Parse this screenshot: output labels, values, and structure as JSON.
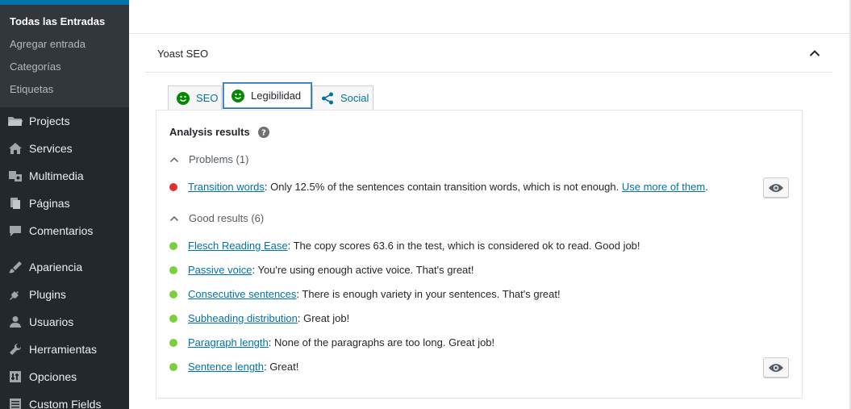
{
  "colors": {
    "sidebar_bg": "#23282d",
    "submenu_bg": "#32373c",
    "accent": "#0073aa",
    "bad": "#dc3232",
    "good": "#7ad03a",
    "yoast_green": "#008a00"
  },
  "sidebar": {
    "submenu": [
      {
        "label": "Todas las Entradas",
        "current": true
      },
      {
        "label": "Agregar entrada"
      },
      {
        "label": "Categorías"
      },
      {
        "label": "Etiquetas"
      }
    ],
    "items": [
      {
        "label": "Projects",
        "icon": "folder-icon"
      },
      {
        "label": "Services",
        "icon": "home-icon"
      },
      {
        "label": "Multimedia",
        "icon": "media-icon"
      },
      {
        "label": "Páginas",
        "icon": "pages-icon"
      },
      {
        "label": "Comentarios",
        "icon": "comments-icon"
      },
      {
        "label": "Apariencia",
        "icon": "appearance-icon"
      },
      {
        "label": "Plugins",
        "icon": "plugins-icon"
      },
      {
        "label": "Usuarios",
        "icon": "users-icon"
      },
      {
        "label": "Herramientas",
        "icon": "tools-icon"
      },
      {
        "label": "Opciones",
        "icon": "settings-icon"
      },
      {
        "label": "Custom Fields",
        "icon": "custom-fields-icon"
      }
    ]
  },
  "metabox": {
    "title": "Yoast SEO",
    "tabs": [
      {
        "label": "SEO",
        "icon": "smiley-icon"
      },
      {
        "label": "Legibilidad",
        "icon": "smiley-icon",
        "active": true
      },
      {
        "label": "Social",
        "icon": "share-icon"
      }
    ],
    "analysis_title": "Analysis results",
    "problems": {
      "heading": "Problems (1)",
      "items": [
        {
          "link": "Transition words",
          "text": ": Only 12.5% of the sentences contain transition words, which is not enough. ",
          "link2": "Use more of them",
          "tail": "."
        }
      ]
    },
    "good": {
      "heading": "Good results (6)",
      "items": [
        {
          "link": "Flesch Reading Ease",
          "text": ": The copy scores 63.6 in the test, which is considered ok to read. Good job!"
        },
        {
          "link": "Passive voice",
          "text": ": You're using enough active voice. That's great!"
        },
        {
          "link": "Consecutive sentences",
          "text": ": There is enough variety in your sentences. That's great!"
        },
        {
          "link": "Subheading distribution",
          "text": ": Great job!"
        },
        {
          "link": "Paragraph length",
          "text": ": None of the paragraphs are too long. Great job!"
        },
        {
          "link": "Sentence length",
          "text": ": Great!"
        }
      ]
    }
  }
}
